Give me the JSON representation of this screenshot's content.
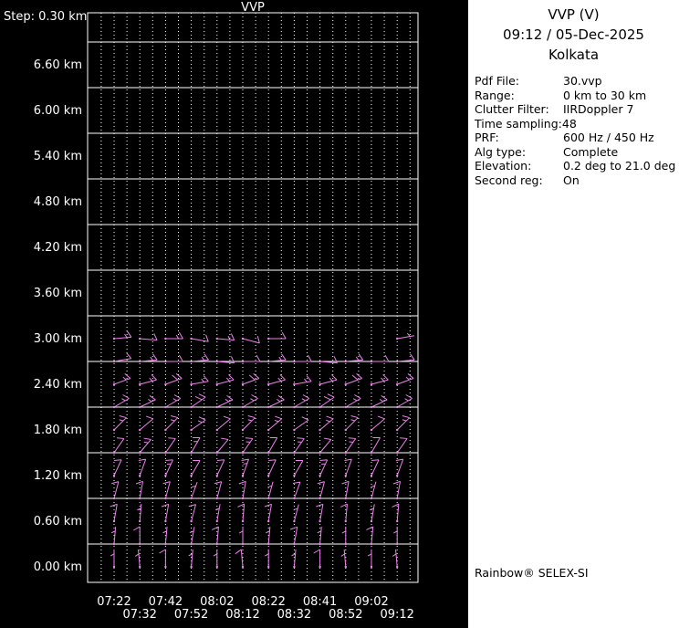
{
  "left": {
    "step_label": "Step: 0.30 km",
    "plot_title": "VVP"
  },
  "right": {
    "title": "VVP (V)",
    "datetime": "09:12 / 05-Dec-2025",
    "site": "Kolkata",
    "params": [
      {
        "label": "Pdf File:",
        "value": "30.vvp"
      },
      {
        "label": "Range:",
        "value": "0 km to 30 km"
      },
      {
        "label": "Clutter Filter:",
        "value": "IIRDoppler 7"
      },
      {
        "label": "Time sampling:48",
        "value": ""
      },
      {
        "label": "PRF:",
        "value": "600 Hz / 450 Hz"
      },
      {
        "label": "Alg type:",
        "value": "Complete"
      },
      {
        "label": "Elevation:",
        "value": "0.2 deg to 21.0 deg"
      },
      {
        "label": "Second reg:",
        "value": "On"
      }
    ],
    "footer": "Rainbow® SELEX-SI"
  },
  "chart_data": {
    "type": "wind-barb-time-height-profile",
    "title": "VVP",
    "step_km": 0.3,
    "x_tick_labels": [
      "07:22",
      "07:32",
      "07:42",
      "07:52",
      "08:02",
      "08:12",
      "08:22",
      "08:32",
      "08:41",
      "08:52",
      "09:02",
      "09:12"
    ],
    "y_tick_labels": [
      "0.00 km",
      "0.60 km",
      "1.20 km",
      "1.80 km",
      "2.40 km",
      "3.00 km",
      "3.60 km",
      "4.20 km",
      "4.80 km",
      "5.40 km",
      "6.00 km",
      "6.60 km"
    ],
    "ylim_km": [
      0.0,
      7.3
    ],
    "grid": {
      "h_line_step_km": 0.6,
      "h_line_start_km": 0.3,
      "v_dotted": true
    },
    "barb_color": "#EE82EE",
    "axis_color": "#ffffff",
    "rows": [
      {
        "alt": 3.0,
        "dirs": [
          85,
          95,
          90,
          100,
          95,
          105,
          90,
          null,
          null,
          null,
          null,
          80
        ],
        "speeds": [
          15,
          10,
          15,
          10,
          15,
          10,
          10,
          null,
          null,
          null,
          null,
          5
        ]
      },
      {
        "alt": 2.7,
        "dirs": [
          80,
          85,
          90,
          85,
          95,
          90,
          85,
          90,
          95,
          85,
          90,
          85
        ],
        "speeds": [
          10,
          15,
          10,
          15,
          10,
          10,
          15,
          10,
          10,
          15,
          10,
          10
        ]
      },
      {
        "alt": 2.4,
        "dirs": [
          70,
          75,
          70,
          80,
          75,
          70,
          75,
          80,
          75,
          70,
          75,
          70
        ],
        "speeds": [
          15,
          15,
          20,
          15,
          15,
          20,
          15,
          15,
          15,
          20,
          15,
          15
        ]
      },
      {
        "alt": 2.1,
        "dirs": [
          60,
          65,
          60,
          55,
          65,
          60,
          65,
          60,
          55,
          60,
          65,
          60
        ],
        "speeds": [
          15,
          15,
          15,
          20,
          15,
          15,
          15,
          15,
          20,
          15,
          15,
          15
        ]
      },
      {
        "alt": 1.8,
        "dirs": [
          45,
          50,
          45,
          55,
          50,
          45,
          50,
          55,
          50,
          45,
          50,
          45
        ],
        "speeds": [
          15,
          10,
          15,
          15,
          10,
          15,
          15,
          10,
          15,
          15,
          10,
          15
        ]
      },
      {
        "alt": 1.5,
        "dirs": [
          35,
          40,
          35,
          30,
          40,
          35,
          30,
          35,
          40,
          35,
          30,
          35
        ],
        "speeds": [
          10,
          15,
          10,
          15,
          10,
          15,
          10,
          15,
          10,
          15,
          10,
          10
        ]
      },
      {
        "alt": 1.2,
        "dirs": [
          25,
          20,
          25,
          30,
          25,
          20,
          25,
          30,
          25,
          20,
          25,
          20
        ],
        "speeds": [
          10,
          10,
          15,
          10,
          10,
          15,
          10,
          10,
          15,
          10,
          10,
          10
        ]
      },
      {
        "alt": 0.9,
        "dirs": [
          15,
          10,
          15,
          20,
          15,
          10,
          15,
          20,
          15,
          10,
          15,
          10
        ],
        "speeds": [
          10,
          10,
          10,
          5,
          10,
          10,
          5,
          10,
          10,
          10,
          5,
          10
        ]
      },
      {
        "alt": 0.6,
        "dirs": [
          10,
          5,
          10,
          15,
          10,
          5,
          10,
          15,
          10,
          5,
          10,
          5
        ],
        "speeds": [
          10,
          5,
          10,
          10,
          5,
          10,
          10,
          5,
          10,
          10,
          5,
          10
        ]
      },
      {
        "alt": 0.3,
        "dirs": [
          5,
          0,
          5,
          10,
          5,
          0,
          5,
          10,
          5,
          0,
          5,
          0
        ],
        "speeds": [
          5,
          10,
          5,
          5,
          10,
          5,
          5,
          10,
          5,
          5,
          10,
          5
        ]
      },
      {
        "alt": 0.0,
        "dirs": [
          0,
          355,
          0,
          5,
          0,
          355,
          0,
          5,
          0,
          355,
          0,
          355
        ],
        "speeds": [
          5,
          5,
          10,
          5,
          5,
          10,
          5,
          5,
          10,
          5,
          5,
          5
        ]
      }
    ]
  }
}
